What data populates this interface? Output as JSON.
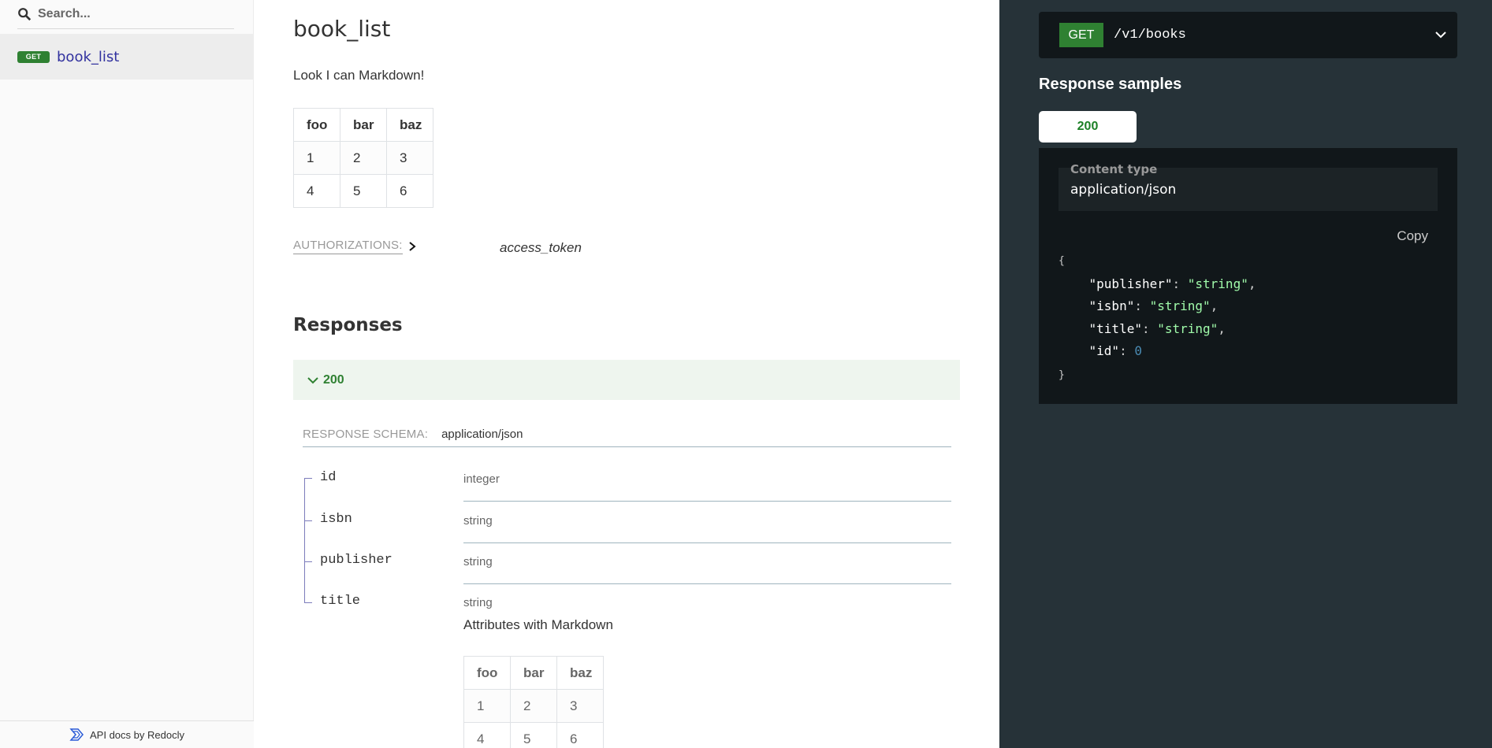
{
  "sidebar": {
    "search_placeholder": "Search...",
    "items": [
      {
        "method": "GET",
        "label": "book_list"
      }
    ],
    "footer": "API docs by Redocly"
  },
  "operation": {
    "title": "book_list",
    "description": "Look I can Markdown!",
    "table": {
      "headers": [
        "foo",
        "bar",
        "baz"
      ],
      "rows": [
        [
          "1",
          "2",
          "3"
        ],
        [
          "4",
          "5",
          "6"
        ]
      ]
    },
    "authorizations_label": "AUTHORIZATIONS:",
    "auth_token": "access_token",
    "responses_title": "Responses",
    "response_code": "200",
    "schema_label": "RESPONSE SCHEMA:",
    "schema_type": "application/json",
    "properties": [
      {
        "name": "id",
        "type": "integer"
      },
      {
        "name": "isbn",
        "type": "string"
      },
      {
        "name": "publisher",
        "type": "string"
      },
      {
        "name": "title",
        "type": "string",
        "description": "Attributes with Markdown"
      }
    ],
    "prop_table": {
      "headers": [
        "foo",
        "bar",
        "baz"
      ],
      "rows": [
        [
          "1",
          "2",
          "3"
        ],
        [
          "4",
          "5",
          "6"
        ]
      ]
    }
  },
  "right_panel": {
    "method": "GET",
    "path": "/v1/books",
    "response_samples_title": "Response samples",
    "tab_label": "200",
    "content_type_label": "Content type",
    "content_type_value": "application/json",
    "copy_label": "Copy",
    "sample": {
      "open": "{",
      "close": "}",
      "lines": [
        {
          "key": "\"publisher\"",
          "value": "\"string\"",
          "kind": "str",
          "comma": ","
        },
        {
          "key": "\"isbn\"",
          "value": "\"string\"",
          "kind": "str",
          "comma": ","
        },
        {
          "key": "\"title\"",
          "value": "\"string\"",
          "kind": "str",
          "comma": ","
        },
        {
          "key": "\"id\"",
          "value": "0",
          "kind": "num",
          "comma": ""
        }
      ]
    }
  },
  "colors": {
    "get_badge": "#2f8132",
    "nav_link": "#32329f",
    "right_bg": "#263238",
    "code_bg": "#11171a",
    "string_value": "#a0fbaa"
  }
}
